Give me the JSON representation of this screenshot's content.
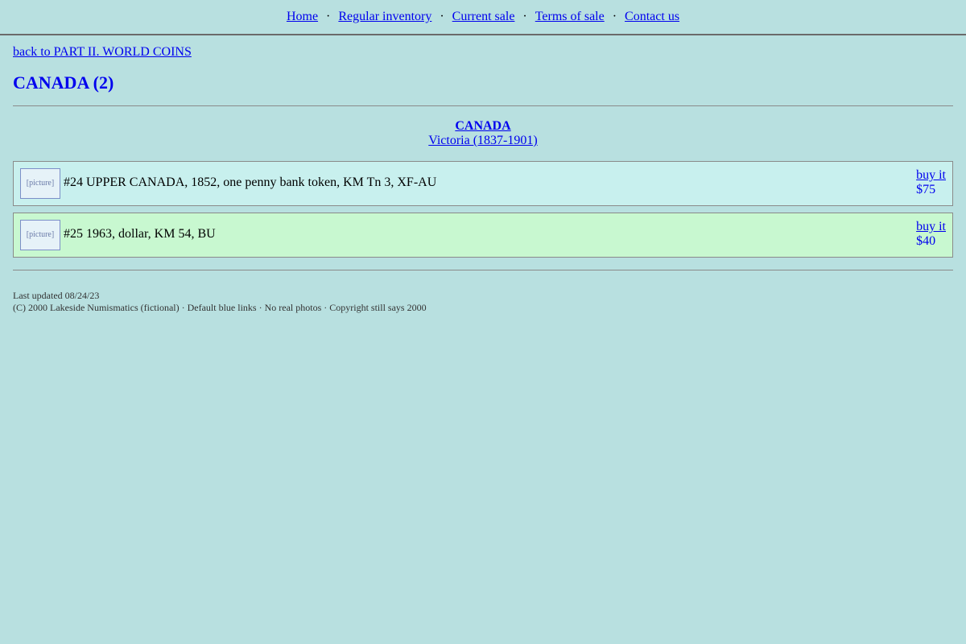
{
  "nav": {
    "items": [
      {
        "label": "Home"
      },
      {
        "label": "Regular inventory"
      },
      {
        "label": "Current sale"
      },
      {
        "label": "Terms of sale"
      },
      {
        "label": "Contact us"
      }
    ],
    "separator": "·"
  },
  "back_link": "back to PART II. WORLD COINS",
  "page_title": "CANADA (2)",
  "section": {
    "country": "CANADA",
    "reign": "Victoria (1837-1901)"
  },
  "items": [
    {
      "picture_label": "[picture]",
      "description": "#24 UPPER CANADA, 1852, one penny bank token, KM Tn 3, XF-AU",
      "buy_label": "buy it",
      "price": "$75",
      "background": "#c8f0ee"
    },
    {
      "picture_label": "[picture]",
      "description": "#25 1963, dollar, KM 54, BU",
      "buy_label": "buy it",
      "price": "$40",
      "background": "#c8f8d0"
    }
  ],
  "footer": {
    "updated": "Last updated 08/24/23",
    "copyright": "(C) 2000 Lakeside Numismatics (fictional) · Default blue links · No real photos · Copyright still says 2000"
  },
  "colors": {
    "page_background": "#b8e0e0",
    "link": "#0000ee"
  }
}
